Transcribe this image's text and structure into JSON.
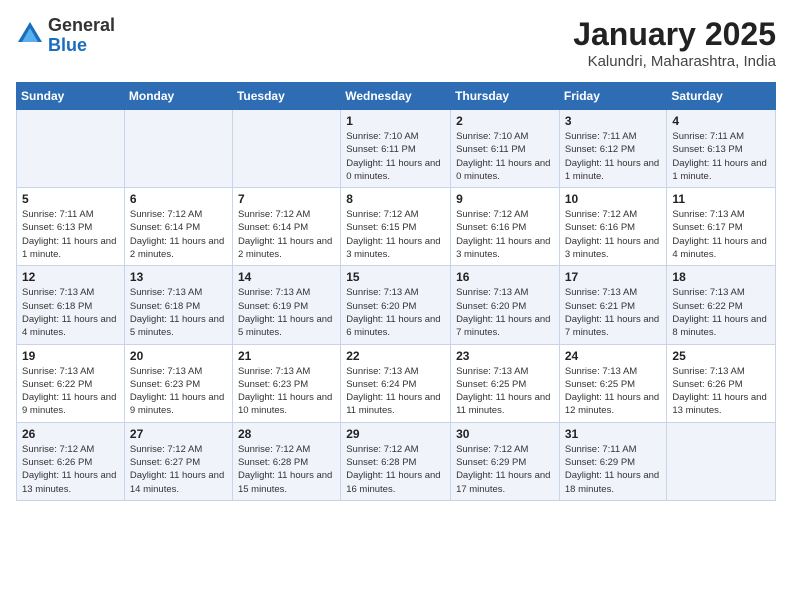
{
  "header": {
    "logo_general": "General",
    "logo_blue": "Blue",
    "title": "January 2025",
    "subtitle": "Kalundri, Maharashtra, India"
  },
  "weekdays": [
    "Sunday",
    "Monday",
    "Tuesday",
    "Wednesday",
    "Thursday",
    "Friday",
    "Saturday"
  ],
  "weeks": [
    [
      {
        "day": "",
        "sunrise": "",
        "sunset": "",
        "daylight": ""
      },
      {
        "day": "",
        "sunrise": "",
        "sunset": "",
        "daylight": ""
      },
      {
        "day": "",
        "sunrise": "",
        "sunset": "",
        "daylight": ""
      },
      {
        "day": "1",
        "sunrise": "Sunrise: 7:10 AM",
        "sunset": "Sunset: 6:11 PM",
        "daylight": "Daylight: 11 hours and 0 minutes."
      },
      {
        "day": "2",
        "sunrise": "Sunrise: 7:10 AM",
        "sunset": "Sunset: 6:11 PM",
        "daylight": "Daylight: 11 hours and 0 minutes."
      },
      {
        "day": "3",
        "sunrise": "Sunrise: 7:11 AM",
        "sunset": "Sunset: 6:12 PM",
        "daylight": "Daylight: 11 hours and 1 minute."
      },
      {
        "day": "4",
        "sunrise": "Sunrise: 7:11 AM",
        "sunset": "Sunset: 6:13 PM",
        "daylight": "Daylight: 11 hours and 1 minute."
      }
    ],
    [
      {
        "day": "5",
        "sunrise": "Sunrise: 7:11 AM",
        "sunset": "Sunset: 6:13 PM",
        "daylight": "Daylight: 11 hours and 1 minute."
      },
      {
        "day": "6",
        "sunrise": "Sunrise: 7:12 AM",
        "sunset": "Sunset: 6:14 PM",
        "daylight": "Daylight: 11 hours and 2 minutes."
      },
      {
        "day": "7",
        "sunrise": "Sunrise: 7:12 AM",
        "sunset": "Sunset: 6:14 PM",
        "daylight": "Daylight: 11 hours and 2 minutes."
      },
      {
        "day": "8",
        "sunrise": "Sunrise: 7:12 AM",
        "sunset": "Sunset: 6:15 PM",
        "daylight": "Daylight: 11 hours and 3 minutes."
      },
      {
        "day": "9",
        "sunrise": "Sunrise: 7:12 AM",
        "sunset": "Sunset: 6:16 PM",
        "daylight": "Daylight: 11 hours and 3 minutes."
      },
      {
        "day": "10",
        "sunrise": "Sunrise: 7:12 AM",
        "sunset": "Sunset: 6:16 PM",
        "daylight": "Daylight: 11 hours and 3 minutes."
      },
      {
        "day": "11",
        "sunrise": "Sunrise: 7:13 AM",
        "sunset": "Sunset: 6:17 PM",
        "daylight": "Daylight: 11 hours and 4 minutes."
      }
    ],
    [
      {
        "day": "12",
        "sunrise": "Sunrise: 7:13 AM",
        "sunset": "Sunset: 6:18 PM",
        "daylight": "Daylight: 11 hours and 4 minutes."
      },
      {
        "day": "13",
        "sunrise": "Sunrise: 7:13 AM",
        "sunset": "Sunset: 6:18 PM",
        "daylight": "Daylight: 11 hours and 5 minutes."
      },
      {
        "day": "14",
        "sunrise": "Sunrise: 7:13 AM",
        "sunset": "Sunset: 6:19 PM",
        "daylight": "Daylight: 11 hours and 5 minutes."
      },
      {
        "day": "15",
        "sunrise": "Sunrise: 7:13 AM",
        "sunset": "Sunset: 6:20 PM",
        "daylight": "Daylight: 11 hours and 6 minutes."
      },
      {
        "day": "16",
        "sunrise": "Sunrise: 7:13 AM",
        "sunset": "Sunset: 6:20 PM",
        "daylight": "Daylight: 11 hours and 7 minutes."
      },
      {
        "day": "17",
        "sunrise": "Sunrise: 7:13 AM",
        "sunset": "Sunset: 6:21 PM",
        "daylight": "Daylight: 11 hours and 7 minutes."
      },
      {
        "day": "18",
        "sunrise": "Sunrise: 7:13 AM",
        "sunset": "Sunset: 6:22 PM",
        "daylight": "Daylight: 11 hours and 8 minutes."
      }
    ],
    [
      {
        "day": "19",
        "sunrise": "Sunrise: 7:13 AM",
        "sunset": "Sunset: 6:22 PM",
        "daylight": "Daylight: 11 hours and 9 minutes."
      },
      {
        "day": "20",
        "sunrise": "Sunrise: 7:13 AM",
        "sunset": "Sunset: 6:23 PM",
        "daylight": "Daylight: 11 hours and 9 minutes."
      },
      {
        "day": "21",
        "sunrise": "Sunrise: 7:13 AM",
        "sunset": "Sunset: 6:23 PM",
        "daylight": "Daylight: 11 hours and 10 minutes."
      },
      {
        "day": "22",
        "sunrise": "Sunrise: 7:13 AM",
        "sunset": "Sunset: 6:24 PM",
        "daylight": "Daylight: 11 hours and 11 minutes."
      },
      {
        "day": "23",
        "sunrise": "Sunrise: 7:13 AM",
        "sunset": "Sunset: 6:25 PM",
        "daylight": "Daylight: 11 hours and 11 minutes."
      },
      {
        "day": "24",
        "sunrise": "Sunrise: 7:13 AM",
        "sunset": "Sunset: 6:25 PM",
        "daylight": "Daylight: 11 hours and 12 minutes."
      },
      {
        "day": "25",
        "sunrise": "Sunrise: 7:13 AM",
        "sunset": "Sunset: 6:26 PM",
        "daylight": "Daylight: 11 hours and 13 minutes."
      }
    ],
    [
      {
        "day": "26",
        "sunrise": "Sunrise: 7:12 AM",
        "sunset": "Sunset: 6:26 PM",
        "daylight": "Daylight: 11 hours and 13 minutes."
      },
      {
        "day": "27",
        "sunrise": "Sunrise: 7:12 AM",
        "sunset": "Sunset: 6:27 PM",
        "daylight": "Daylight: 11 hours and 14 minutes."
      },
      {
        "day": "28",
        "sunrise": "Sunrise: 7:12 AM",
        "sunset": "Sunset: 6:28 PM",
        "daylight": "Daylight: 11 hours and 15 minutes."
      },
      {
        "day": "29",
        "sunrise": "Sunrise: 7:12 AM",
        "sunset": "Sunset: 6:28 PM",
        "daylight": "Daylight: 11 hours and 16 minutes."
      },
      {
        "day": "30",
        "sunrise": "Sunrise: 7:12 AM",
        "sunset": "Sunset: 6:29 PM",
        "daylight": "Daylight: 11 hours and 17 minutes."
      },
      {
        "day": "31",
        "sunrise": "Sunrise: 7:11 AM",
        "sunset": "Sunset: 6:29 PM",
        "daylight": "Daylight: 11 hours and 18 minutes."
      },
      {
        "day": "",
        "sunrise": "",
        "sunset": "",
        "daylight": ""
      }
    ]
  ]
}
